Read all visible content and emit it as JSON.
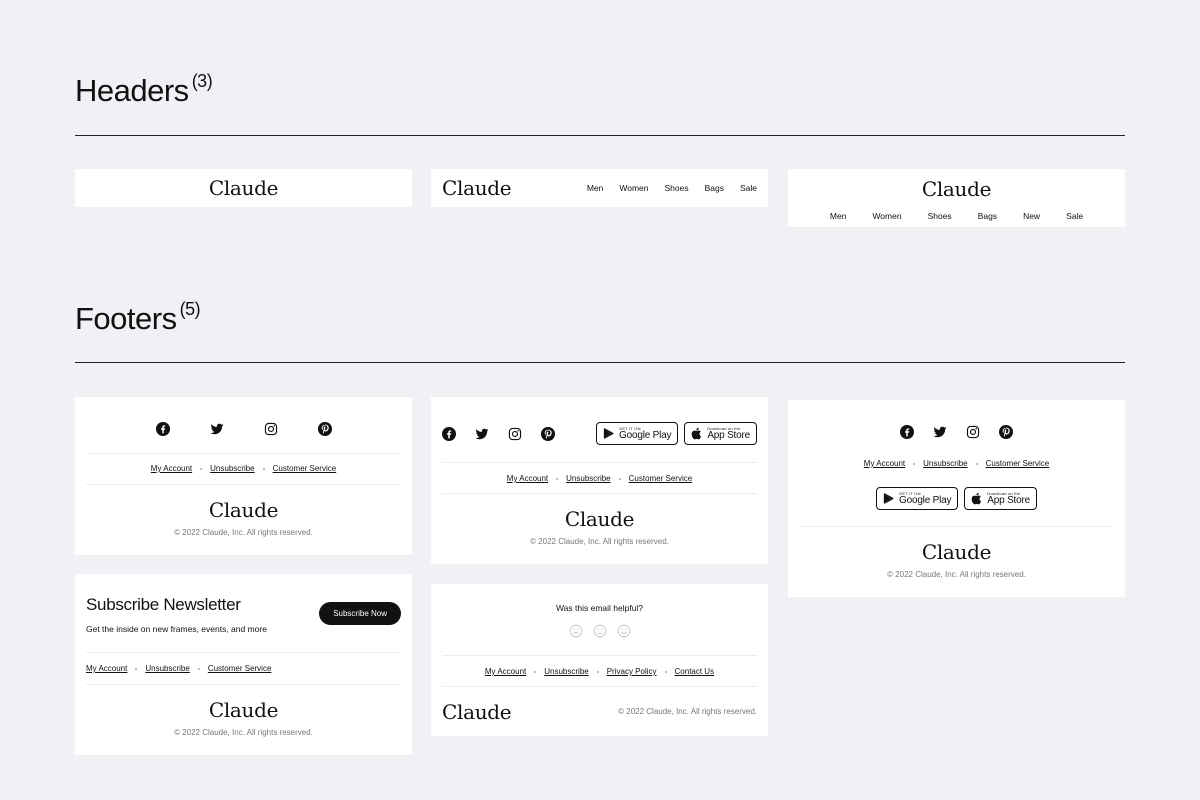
{
  "sections": {
    "headers": {
      "title": "Headers",
      "count": "(3)"
    },
    "footers": {
      "title": "Footers",
      "count": "(5)"
    }
  },
  "brand": {
    "logo": "Claude"
  },
  "header1": {
    "logo": "Claude"
  },
  "header2": {
    "logo": "Claude",
    "nav": [
      "Men",
      "Women",
      "Shoes",
      "Bags",
      "Sale"
    ]
  },
  "header3": {
    "logo": "Claude",
    "nav": [
      "Men",
      "Women",
      "Shoes",
      "Bags",
      "New",
      "Sale"
    ]
  },
  "footer_links": {
    "my_account": "My Account",
    "unsubscribe": "Unsubscribe",
    "customer_service": "Customer Service"
  },
  "footer_links_extended": {
    "my_account": "My Account",
    "unsubscribe": "Unsubscribe",
    "privacy_policy": "Privacy Policy",
    "contact_us": "Contact Us"
  },
  "copyright": "© 2022 Claude, Inc. All rights reserved.",
  "stores": {
    "google": {
      "small": "GET IT ON",
      "big": "Google Play"
    },
    "apple": {
      "small": "Download on the",
      "big": "App Store"
    }
  },
  "newsletter": {
    "title": "Subscribe Newsletter",
    "subtitle": "Get the inside on new frames, events, and more",
    "button": "Subscribe Now"
  },
  "feedback": {
    "question": "Was this email helpful?"
  },
  "icons": {
    "social": [
      "facebook-icon",
      "twitter-icon",
      "instagram-icon",
      "pinterest-icon"
    ],
    "faces": [
      "sad-face-icon",
      "neutral-face-icon",
      "happy-face-icon"
    ],
    "stores": [
      "google-play-icon",
      "apple-icon"
    ]
  },
  "colors": {
    "background": "#f0f1f5",
    "card": "#ffffff",
    "text": "#111111",
    "muted": "#777777"
  }
}
